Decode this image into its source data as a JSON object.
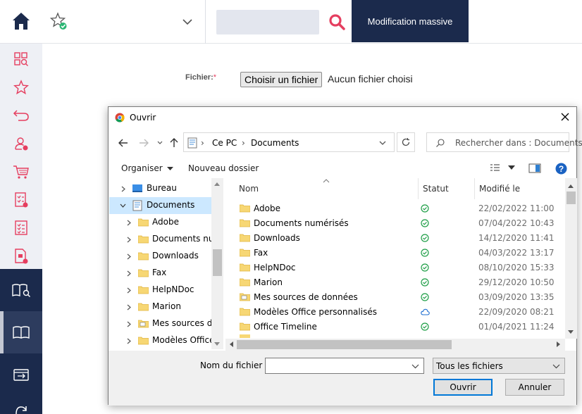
{
  "topbar": {
    "home_icon": "home-icon",
    "favorite_icon": "star-check-icon",
    "search_placeholder": "",
    "mass_edit_label": "Modification massive",
    "accent": "#e53e5f",
    "nav_color": "#1b2a4c"
  },
  "sidebar": {
    "items": [
      {
        "icon": "grid-search-icon"
      },
      {
        "icon": "star-icon"
      },
      {
        "icon": "undo-icon"
      },
      {
        "icon": "user-add-icon"
      },
      {
        "icon": "cart-icon"
      },
      {
        "icon": "checklist-add-icon"
      },
      {
        "icon": "checklist-icon"
      },
      {
        "icon": "document-add-icon"
      },
      {
        "icon": "book-search-icon"
      },
      {
        "icon": "book-icon"
      },
      {
        "icon": "transfer-icon"
      },
      {
        "icon": "refresh-icon"
      }
    ]
  },
  "form": {
    "file_label": "Fichier:",
    "required_mark": "*",
    "choose_button": "Choisir un fichier",
    "no_file": "Aucun fichier choisi"
  },
  "dialog": {
    "title": "Ouvrir",
    "address": [
      "Ce PC",
      "Documents"
    ],
    "search_placeholder": "Rechercher dans : Documents",
    "organize": "Organiser",
    "new_folder": "Nouveau dossier",
    "tree": [
      {
        "label": "Bureau",
        "level": 0,
        "icon": "desktop-icon"
      },
      {
        "label": "Documents",
        "level": 0,
        "icon": "documents-icon",
        "selected": true
      },
      {
        "label": "Adobe",
        "level": 1
      },
      {
        "label": "Documents num",
        "level": 1
      },
      {
        "label": "Downloads",
        "level": 1
      },
      {
        "label": "Fax",
        "level": 1
      },
      {
        "label": "HelpNDoc",
        "level": 1
      },
      {
        "label": "Marion",
        "level": 1
      },
      {
        "label": "Mes sources de",
        "level": 1,
        "icon": "datasource-folder-icon"
      },
      {
        "label": "Modèles Office p",
        "level": 1
      }
    ],
    "columns": {
      "name": "Nom",
      "status": "Statut",
      "modified": "Modifié le"
    },
    "files": [
      {
        "name": "Adobe",
        "status": "synced",
        "date": "22/02/2022 11:00"
      },
      {
        "name": "Documents numérisés",
        "status": "synced",
        "date": "07/04/2022 10:43"
      },
      {
        "name": "Downloads",
        "status": "synced",
        "date": "14/12/2020 11:41"
      },
      {
        "name": "Fax",
        "status": "synced",
        "date": "04/03/2022 13:17"
      },
      {
        "name": "HelpNDoc",
        "status": "synced",
        "date": "08/10/2020 15:33"
      },
      {
        "name": "Marion",
        "status": "synced",
        "date": "29/12/2020 10:50"
      },
      {
        "name": "Mes sources de données",
        "status": "synced",
        "date": "03/09/2020 13:35"
      },
      {
        "name": "Modèles Office personnalisés",
        "status": "cloud",
        "date": "22/09/2020 08:21"
      },
      {
        "name": "Office Timeline",
        "status": "synced",
        "date": "01/04/2021 11:24"
      }
    ],
    "filename_label": "Nom du fichier :",
    "filename_value": "",
    "filetype": "Tous les fichiers",
    "open_button": "Ouvrir",
    "cancel_button": "Annuler"
  }
}
